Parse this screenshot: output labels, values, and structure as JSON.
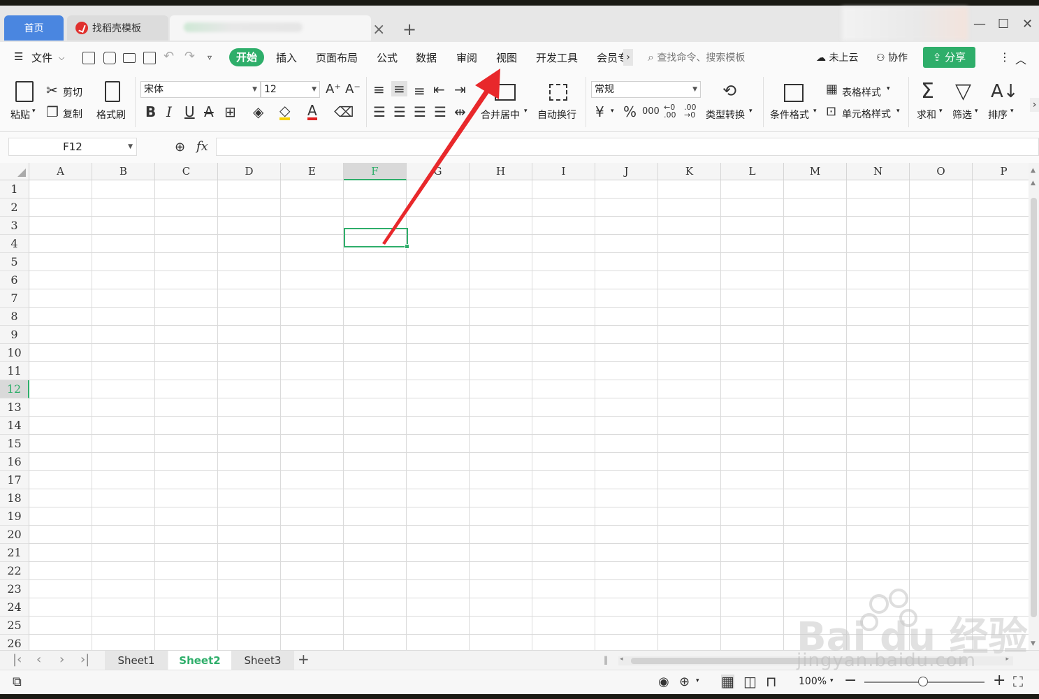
{
  "tabs": {
    "home": "首页",
    "template": "找稻壳模板"
  },
  "menu": {
    "file": "文件",
    "start": "开始",
    "items": [
      "插入",
      "页面布局",
      "公式",
      "数据",
      "审阅",
      "视图",
      "开发工具",
      "会员专"
    ],
    "search_placeholder": "查找命令、搜索模板",
    "cloud": "未上云",
    "collab": "协作",
    "share": "分享"
  },
  "ribbon": {
    "paste": "粘贴",
    "cut": "剪切",
    "copy": "复制",
    "format_painter": "格式刷",
    "font_name": "宋体",
    "font_size": "12",
    "merge_center": "合并居中",
    "wrap_text": "自动换行",
    "number_format": "常规",
    "type_convert": "类型转换",
    "conditional_format": "条件格式",
    "table_style": "表格样式",
    "cell_style": "单元格样式",
    "sum": "求和",
    "filter": "筛选",
    "sort": "排序",
    "currency_symbol": "¥",
    "percent_symbol": "%",
    "thousands_symbol": "000"
  },
  "formula_bar": {
    "cell_ref": "F12",
    "fx": "fx",
    "value": ""
  },
  "grid": {
    "columns": [
      "A",
      "B",
      "C",
      "D",
      "E",
      "F",
      "G",
      "H",
      "I",
      "J",
      "K",
      "L",
      "M",
      "N",
      "O",
      "P"
    ],
    "rows": [
      "1",
      "2",
      "3",
      "4",
      "5",
      "6",
      "7",
      "8",
      "9",
      "10",
      "11",
      "12",
      "13",
      "14",
      "15",
      "16",
      "17",
      "18",
      "19",
      "20",
      "21",
      "22",
      "23",
      "24",
      "25",
      "26"
    ],
    "selected_column": "F",
    "selected_row": "12"
  },
  "sheets": {
    "items": [
      "Sheet1",
      "Sheet2",
      "Sheet3"
    ],
    "active": "Sheet2"
  },
  "status": {
    "zoom": "100%"
  },
  "watermark": {
    "brand": "Bai du 经验",
    "url": "jingyan.baidu.com"
  },
  "colors": {
    "accent": "#2eae6a",
    "home_tab": "#4a86e0",
    "arrow": "#e8282b"
  }
}
